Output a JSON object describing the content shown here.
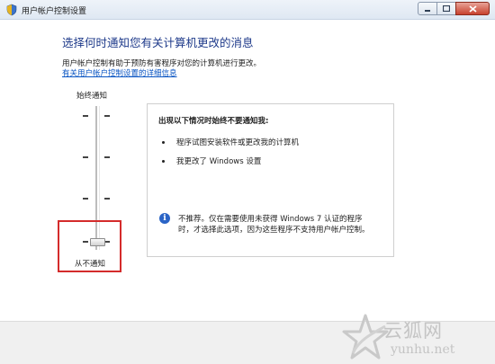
{
  "window": {
    "title": "用户帐户控制设置",
    "icon": "uac-shield-icon",
    "buttons": [
      "minimize",
      "maximize",
      "close"
    ]
  },
  "main": {
    "heading": "选择何时通知您有关计算机更改的消息",
    "description": "用户帐户控制有助于预防有害程序对您的计算机进行更改。",
    "link": "有关用户帐户控制设置的详细信息"
  },
  "slider": {
    "top_label": "始终通知",
    "bottom_label": "从不通知",
    "levels": 4,
    "selected_level": 1,
    "highlight_color": "#d42b2b"
  },
  "panel": {
    "title": "出现以下情况时始终不要通知我:",
    "bullets": [
      "程序试图安装软件或更改我的计算机",
      "我更改了 Windows 设置"
    ],
    "note": "不推荐。仅在需要使用未获得 Windows 7 认证的程序时，才选择此选项，因为这些程序不支持用户帐户控制。",
    "note_icon": "info-icon"
  },
  "watermark": {
    "cn": "云狐网",
    "en": "yunhu.net"
  }
}
